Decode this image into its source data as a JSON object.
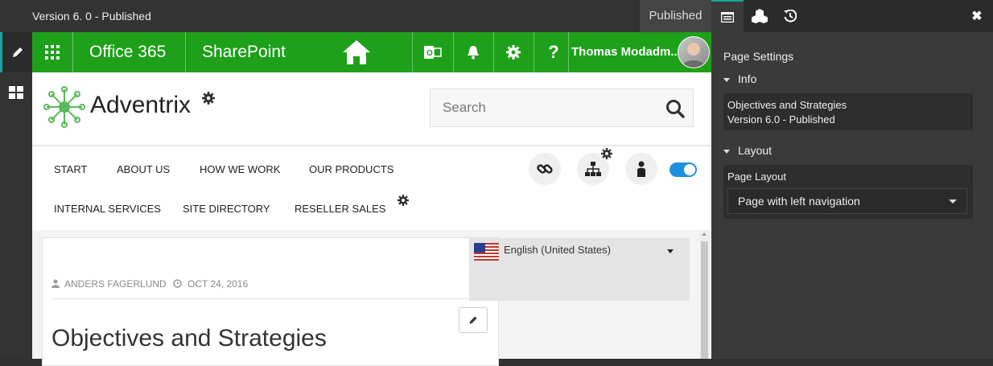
{
  "topbar": {
    "version": "Version 6. 0 - Published",
    "status": "Published"
  },
  "o365": {
    "office_label": "Office 365",
    "sharepoint_label": "SharePoint",
    "user_name": "Thomas Modadm..."
  },
  "site": {
    "logo_text": "Adventrix",
    "search_placeholder": "Search",
    "nav": {
      "row1": [
        "START",
        "ABOUT US",
        "HOW WE WORK",
        "OUR PRODUCTS"
      ],
      "row2": [
        "INTERNAL SERVICES",
        "SITE DIRECTORY",
        "RESELLER SALES"
      ]
    }
  },
  "content": {
    "language": "English (United States)",
    "author": "ANDERS FAGERLUND",
    "date": "OCT 24, 2016",
    "title": "Objectives and Strategies"
  },
  "panel": {
    "title": "Page Settings",
    "info_section": "Info",
    "info_line1": "Objectives and Strategies",
    "info_line2": "Version 6.0 - Published",
    "layout_section": "Layout",
    "layout_label": "Page Layout",
    "layout_value": "Page with left navigation"
  },
  "colors": {
    "o365_green": "#1ea01a",
    "accent": "#16a5a0",
    "toggle_blue": "#1e90e0"
  }
}
